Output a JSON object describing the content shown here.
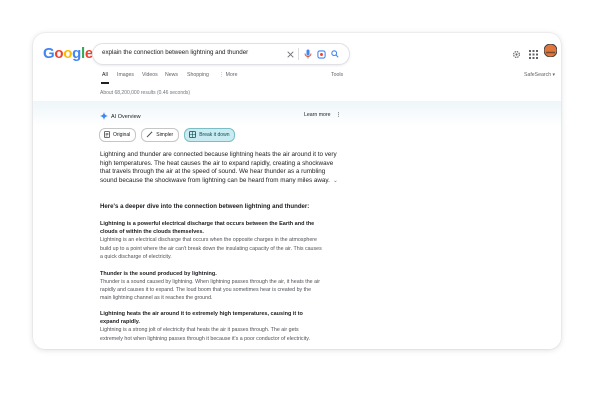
{
  "logo": {
    "letters": [
      "G",
      "o",
      "o",
      "g",
      "l",
      "e"
    ],
    "colors": [
      "#4285f4",
      "#ea4335",
      "#fbbc05",
      "#4285f4",
      "#34a853",
      "#ea4335"
    ]
  },
  "search": {
    "query": "explain the connection between lightning and thunder"
  },
  "tabs": [
    "All",
    "Images",
    "Videos",
    "News",
    "Shopping",
    "⋮ More"
  ],
  "tools": "Tools",
  "safesearch": "SafeSearch ▾",
  "results_count": "About 68,200,000 results (0.46 seconds)",
  "ai_overview": {
    "label": "AI Overview",
    "learn_more": "Learn more",
    "chips": [
      "Original",
      "Simpler",
      "Break it down"
    ],
    "selected_chip": "Break it down",
    "summary": "Lightning and thunder are connected because lightning heats the air around it to very high temperatures. The heat causes the air to expand rapidly, creating a shockwave that travels through the air at the speed of sound. We hear thunder as a rumbling sound because the shockwave from lightning can be heard from many miles away.",
    "deeper_heading": "Here's a deeper dive into the connection between lightning and thunder:",
    "sections": [
      {
        "title": "Lightning is a powerful electrical discharge that occurs between the Earth and the clouds of within the clouds themselves.",
        "body": "Lightning is an electrical discharge that occurs when the opposite charges in the atmosphere build up to a point where the air can't break down the insulating capacity of the air. This causes a quick discharge of electricity."
      },
      {
        "title": "Thunder is the sound produced by lightning.",
        "body": "Thunder is a sound caused by lightning. When lightning passes through the air, it heats the air rapidly and causes it to expand. The loud boom that you sometimes hear is created by the main lightning channel as it reaches the ground."
      },
      {
        "title": "Lightning heats the air around it to extremely high temperatures, causing it to expand rapidly.",
        "body": "Lightning is a strong jolt of electricity that heats the air it passes through. The air gets extremely hot when lightning passes through it because it's a poor conductor of electricity."
      }
    ]
  },
  "colors": {
    "accent": "#1a73e8",
    "chip_selected": "#c8ecf1"
  }
}
